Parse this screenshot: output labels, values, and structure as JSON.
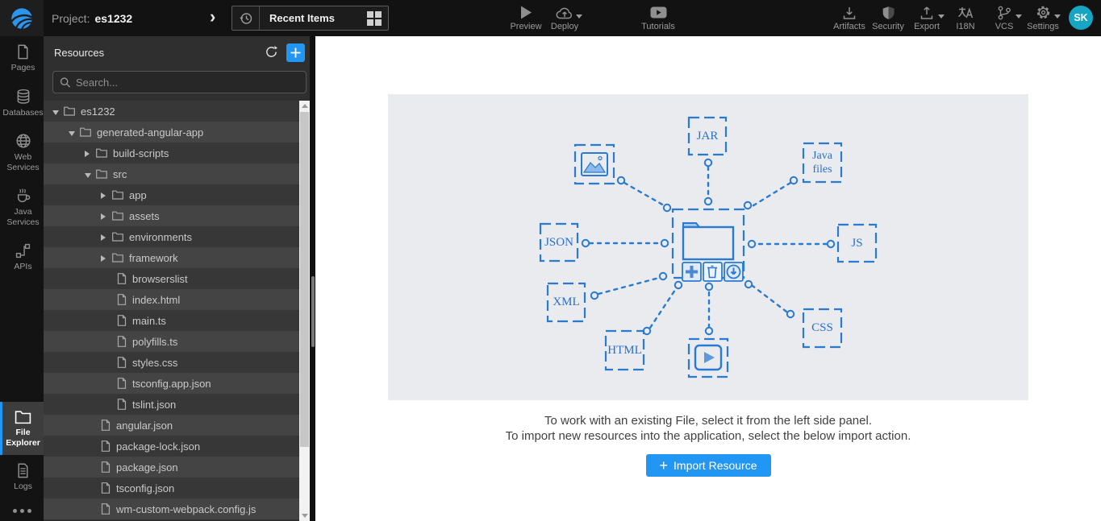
{
  "header": {
    "project_label": "Project:",
    "project_name": "es1232",
    "breadcrumb_chevron": "›",
    "recent_items_label": "Recent Items",
    "menu": {
      "preview": "Preview",
      "deploy": "Deploy",
      "tutorials": "Tutorials",
      "artifacts": "Artifacts",
      "security": "Security",
      "export": "Export",
      "i18n": "I18N",
      "i18n_glyph": "A",
      "vcs": "VCS",
      "settings": "Settings"
    },
    "avatar_initials": "SK"
  },
  "sidebar": {
    "items": [
      {
        "label": "Pages",
        "icon": "page-icon",
        "active": false
      },
      {
        "label": "Databases",
        "icon": "database-icon",
        "active": false
      },
      {
        "label": "Web Services",
        "icon": "globe-icon",
        "active": false
      },
      {
        "label": "Java Services",
        "icon": "coffee-icon",
        "active": false
      },
      {
        "label": "APIs",
        "icon": "api-nodes-icon",
        "active": false
      },
      {
        "label": "File Explorer",
        "icon": "folder-icon",
        "active": true
      },
      {
        "label": "Logs",
        "icon": "log-file-icon",
        "active": false
      }
    ]
  },
  "resources_panel": {
    "title": "Resources",
    "search_placeholder": "Search...",
    "tree": [
      {
        "label": "es1232",
        "type": "folder",
        "level": 0,
        "state": "expanded"
      },
      {
        "label": "generated-angular-app",
        "type": "folder",
        "level": 1,
        "state": "expanded"
      },
      {
        "label": "build-scripts",
        "type": "folder",
        "level": 2,
        "state": "collapsed"
      },
      {
        "label": "src",
        "type": "folder",
        "level": 2,
        "state": "expanded"
      },
      {
        "label": "app",
        "type": "folder",
        "level": 3,
        "state": "collapsed"
      },
      {
        "label": "assets",
        "type": "folder",
        "level": 3,
        "state": "collapsed"
      },
      {
        "label": "environments",
        "type": "folder",
        "level": 3,
        "state": "collapsed"
      },
      {
        "label": "framework",
        "type": "folder",
        "level": 3,
        "state": "collapsed"
      },
      {
        "label": "browserslist",
        "type": "file",
        "level": 4
      },
      {
        "label": "index.html",
        "type": "file",
        "level": 4
      },
      {
        "label": "main.ts",
        "type": "file",
        "level": 4
      },
      {
        "label": "polyfills.ts",
        "type": "file",
        "level": 4
      },
      {
        "label": "styles.css",
        "type": "file",
        "level": 4
      },
      {
        "label": "tsconfig.app.json",
        "type": "file",
        "level": 4
      },
      {
        "label": "tslint.json",
        "type": "file",
        "level": 4
      },
      {
        "label": "angular.json",
        "type": "file",
        "level": 3
      },
      {
        "label": "package-lock.json",
        "type": "file",
        "level": 3
      },
      {
        "label": "package.json",
        "type": "file",
        "level": 3
      },
      {
        "label": "tsconfig.json",
        "type": "file",
        "level": 3
      },
      {
        "label": "wm-custom-webpack.config.js",
        "type": "file",
        "level": 3
      }
    ]
  },
  "main": {
    "illustration": {
      "nodes": [
        {
          "label": "JAR"
        },
        {
          "label": "Java files"
        },
        {
          "label": "JSON"
        },
        {
          "label": "JS"
        },
        {
          "label": "XML"
        },
        {
          "label": "CSS"
        },
        {
          "label": "HTML"
        }
      ],
      "icons": [
        "image-icon",
        "video-icon",
        "folder-icon",
        "add-icon",
        "trash-icon",
        "download-icon"
      ]
    },
    "instructions": {
      "line1": "To work with an existing File, select it from the left side panel.",
      "line2": "To import new resources into the application, select the below import action."
    },
    "import_button": {
      "plus_glyph": "+",
      "label": "Import Resource"
    }
  },
  "colors": {
    "accent_blue": "#2196f3",
    "illustration_blue": "#2a7ad2",
    "illustration_bg": "#e9ebee",
    "avatar_bg": "#16a5c2",
    "topbar_bg": "#121212",
    "panel_bg": "#2f2f2f"
  }
}
